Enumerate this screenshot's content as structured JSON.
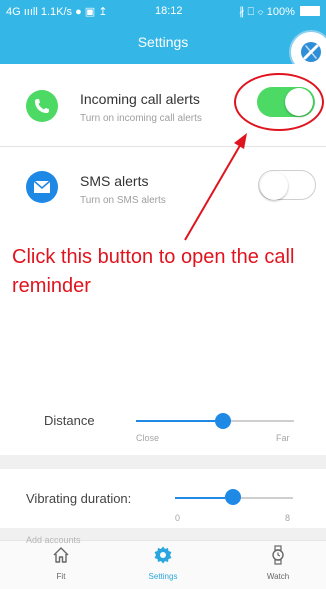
{
  "status_bar": {
    "left_text": "4G ıııll 1.1K/s ● ▣ ↥",
    "time": "18:12",
    "right_text": "∦ ⎕ ⌔ 100%"
  },
  "app_bar": {
    "title": "Settings"
  },
  "alerts": [
    {
      "title": "Incoming call alerts",
      "subtitle": "Turn on incoming call alerts",
      "enabled": true,
      "icon": "phone-icon",
      "icon_color": "#4cd964"
    },
    {
      "title": "SMS alerts",
      "subtitle": "Turn on SMS alerts",
      "enabled": false,
      "icon": "envelope-icon",
      "icon_color": "#1e88e5"
    }
  ],
  "annotation": {
    "text": "Click this button to open the call reminder",
    "color": "#e0141e"
  },
  "distance": {
    "label": "Distance",
    "min_label": "Close",
    "max_label": "Far",
    "value_fraction": 0.55
  },
  "vibration": {
    "label": "Vibrating duration:",
    "min_label": "0",
    "max_label": "8",
    "value_fraction": 0.49
  },
  "partial_row_label": "Add accounts",
  "tabs": [
    {
      "label": "Fit",
      "icon": "home-icon",
      "active": false
    },
    {
      "label": "Settings",
      "icon": "gear-icon",
      "active": true
    },
    {
      "label": "Watch",
      "icon": "watch-icon",
      "active": false
    }
  ],
  "colors": {
    "header": "#34b6e6",
    "toggle_on": "#4cd964",
    "slider": "#1f8ae6",
    "active_tab": "#29a6df",
    "inactive_tab": "#666666"
  }
}
